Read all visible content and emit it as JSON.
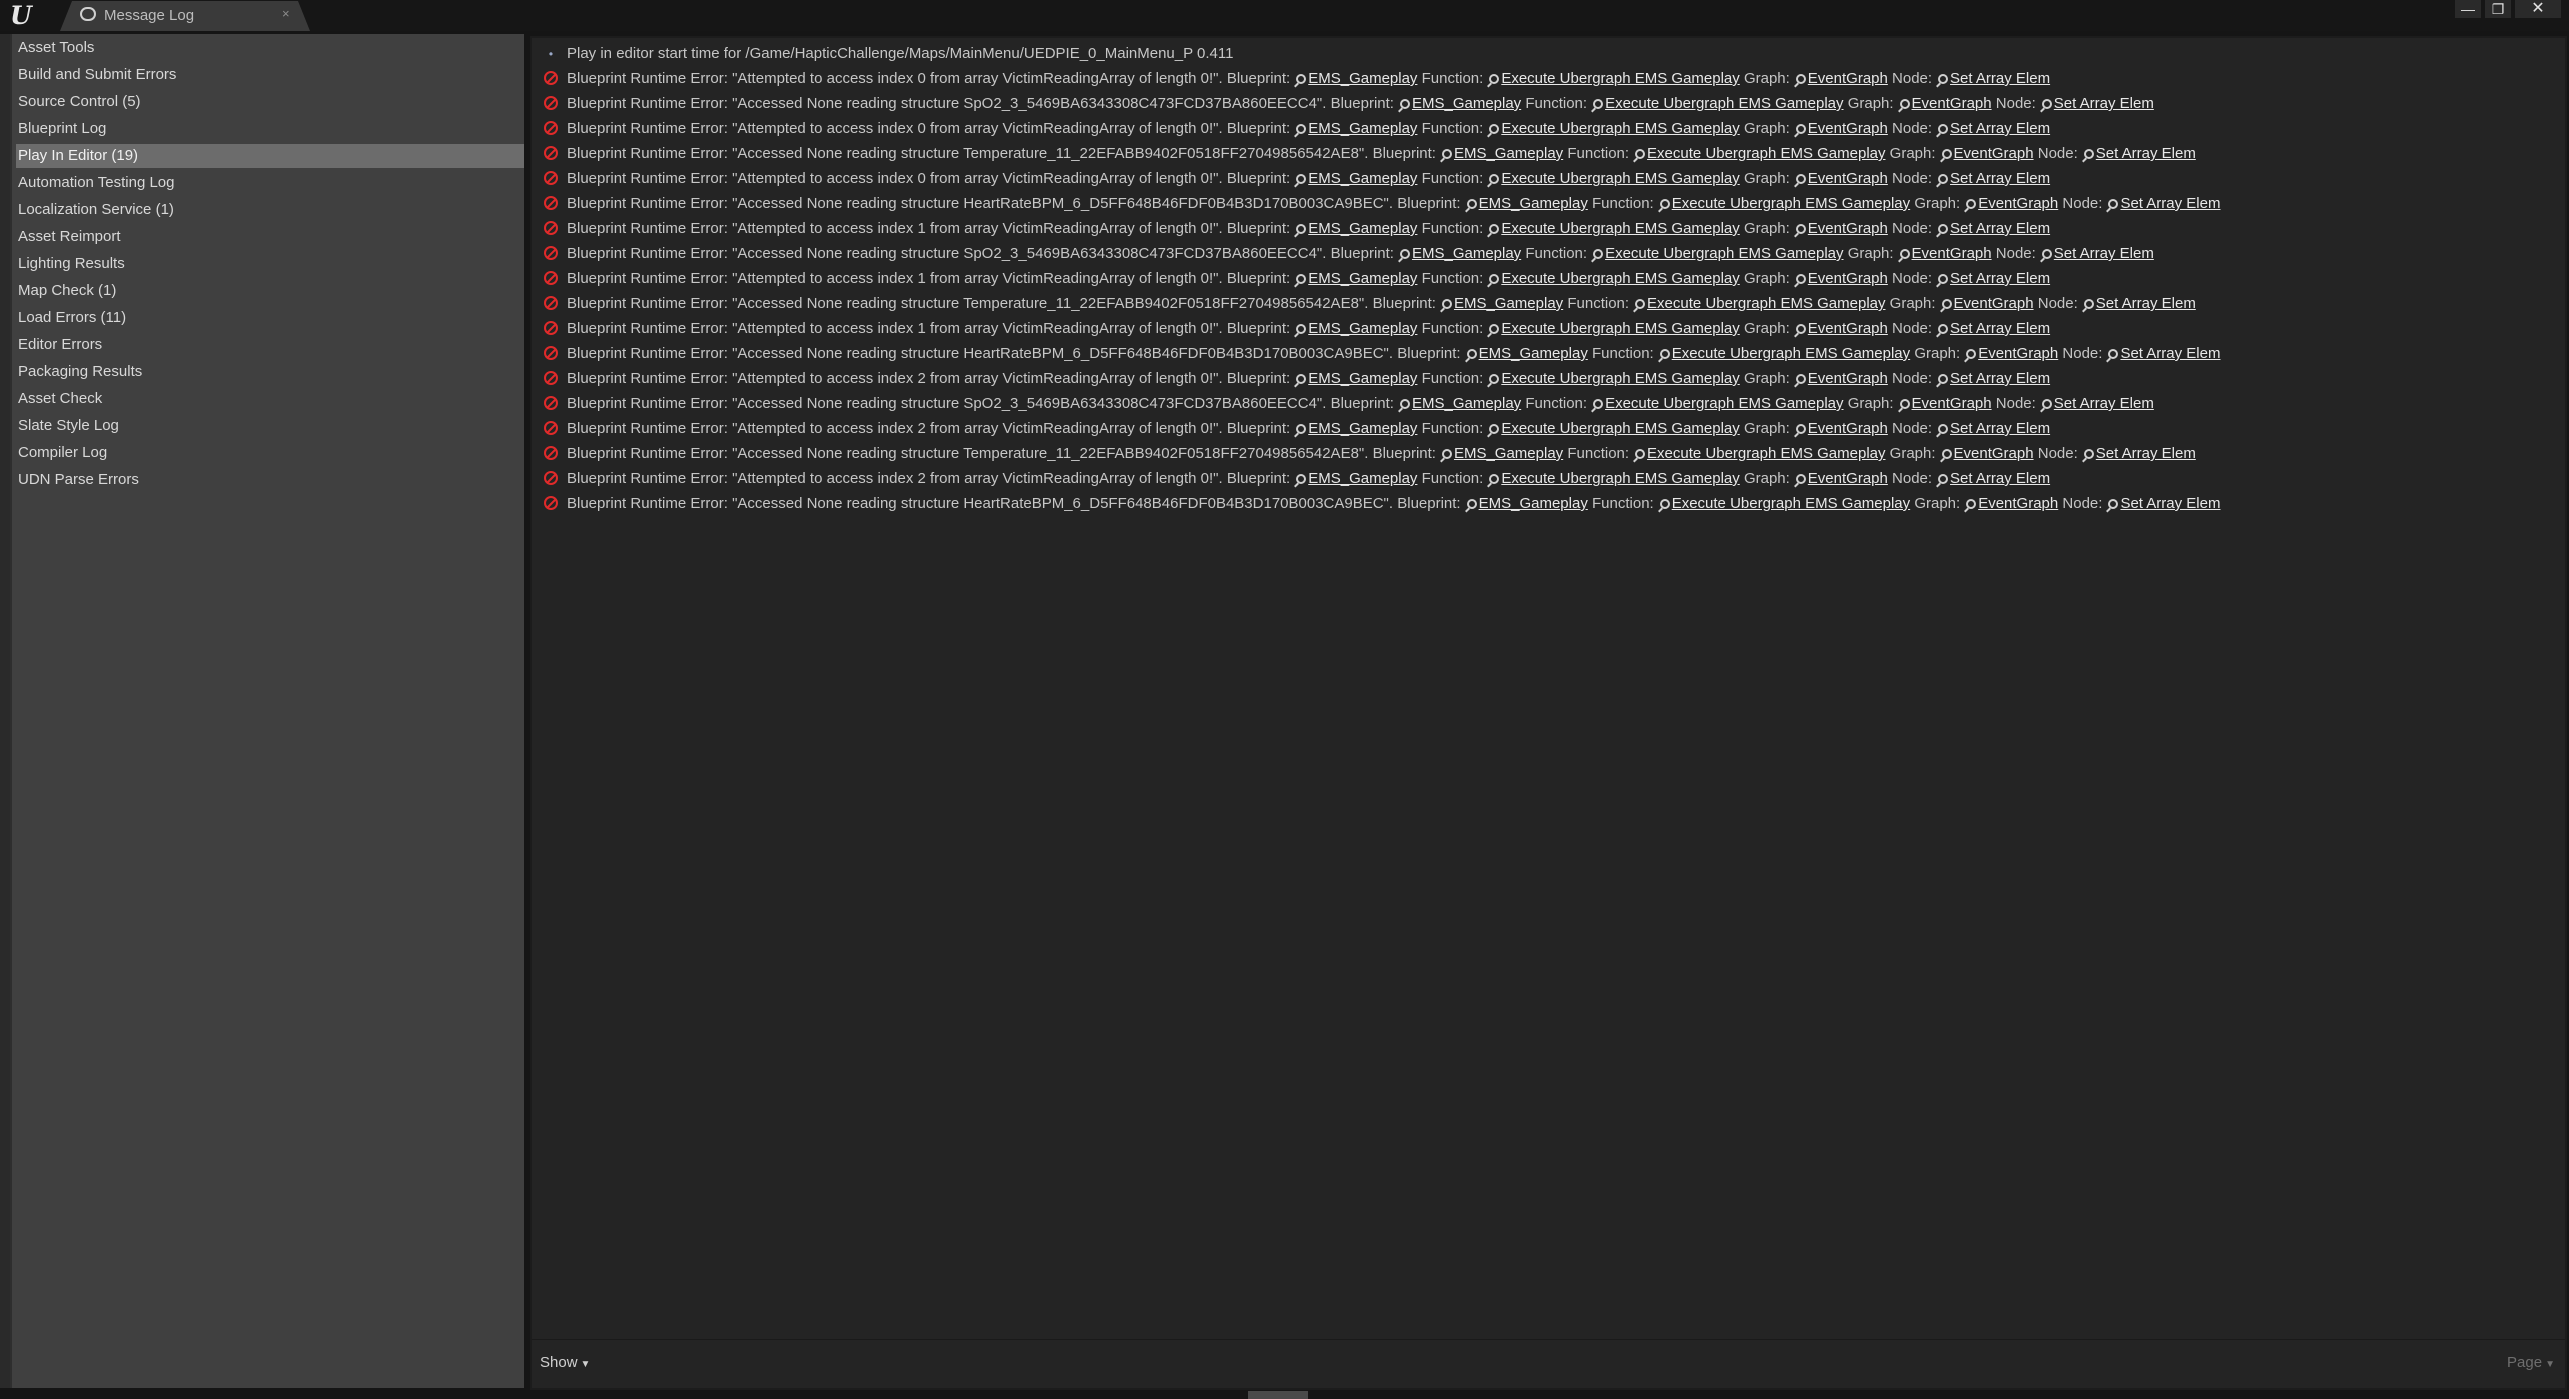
{
  "tab": {
    "title": "Message Log",
    "close": "×"
  },
  "window": {
    "minimize": "—",
    "maximize": "❐",
    "close": "✕"
  },
  "categories": [
    "Asset Tools",
    "Build and Submit Errors",
    "Source Control (5)",
    "Blueprint Log",
    "Play In Editor (19)",
    "Automation Testing Log",
    "Localization Service (1)",
    "Asset Reimport",
    "Lighting Results",
    "Map Check (1)",
    "Load Errors (11)",
    "Editor Errors",
    "Packaging Results",
    "Asset Check",
    "Slate Style Log",
    "Compiler Log",
    "UDN Parse Errors"
  ],
  "selected_category": "Play In Editor (19)",
  "log": {
    "first": "Play in editor start time for /Game/HapticChallenge/Maps/MainMenu/UEDPIE_0_MainMenu_P 0.411",
    "prefix": "Blueprint Runtime Error: ",
    "bp_label": "Blueprint:",
    "fn_label": "Function:",
    "graph_label": "Graph:",
    "node_label": "Node:",
    "blueprint": "EMS_Gameplay",
    "function": "Execute Ubergraph EMS Gameplay",
    "graph": "EventGraph",
    "node": "Set Array Elem",
    "messages": [
      "\"Attempted to access index 0 from array VictimReadingArray of length 0!\".",
      "\"Accessed None reading structure SpO2_3_5469BA6343308C473FCD37BA860EECC4\".",
      "\"Attempted to access index 0 from array VictimReadingArray of length 0!\".",
      "\"Accessed None reading structure Temperature_11_22EFABB9402F0518FF27049856542AE8\".",
      "\"Attempted to access index 0 from array VictimReadingArray of length 0!\".",
      "\"Accessed None reading structure HeartRateBPM_6_D5FF648B46FDF0B4B3D170B003CA9BEC\".",
      "\"Attempted to access index 1 from array VictimReadingArray of length 0!\".",
      "\"Accessed None reading structure SpO2_3_5469BA6343308C473FCD37BA860EECC4\".",
      "\"Attempted to access index 1 from array VictimReadingArray of length 0!\".",
      "\"Accessed None reading structure Temperature_11_22EFABB9402F0518FF27049856542AE8\".",
      "\"Attempted to access index 1 from array VictimReadingArray of length 0!\".",
      "\"Accessed None reading structure HeartRateBPM_6_D5FF648B46FDF0B4B3D170B003CA9BEC\".",
      "\"Attempted to access index 2 from array VictimReadingArray of length 0!\".",
      "\"Accessed None reading structure SpO2_3_5469BA6343308C473FCD37BA860EECC4\".",
      "\"Attempted to access index 2 from array VictimReadingArray of length 0!\".",
      "\"Accessed None reading structure Temperature_11_22EFABB9402F0518FF27049856542AE8\".",
      "\"Attempted to access index 2 from array VictimReadingArray of length 0!\".",
      "\"Accessed None reading structure HeartRateBPM_6_D5FF648B46FDF0B4B3D170B003CA9BEC\"."
    ]
  },
  "footer": {
    "show": "Show",
    "page": "Page"
  },
  "colors": {
    "error": "#e02a2a",
    "selected": "#6c6c6c",
    "panel": "#242424",
    "sidebar": "#404040"
  }
}
